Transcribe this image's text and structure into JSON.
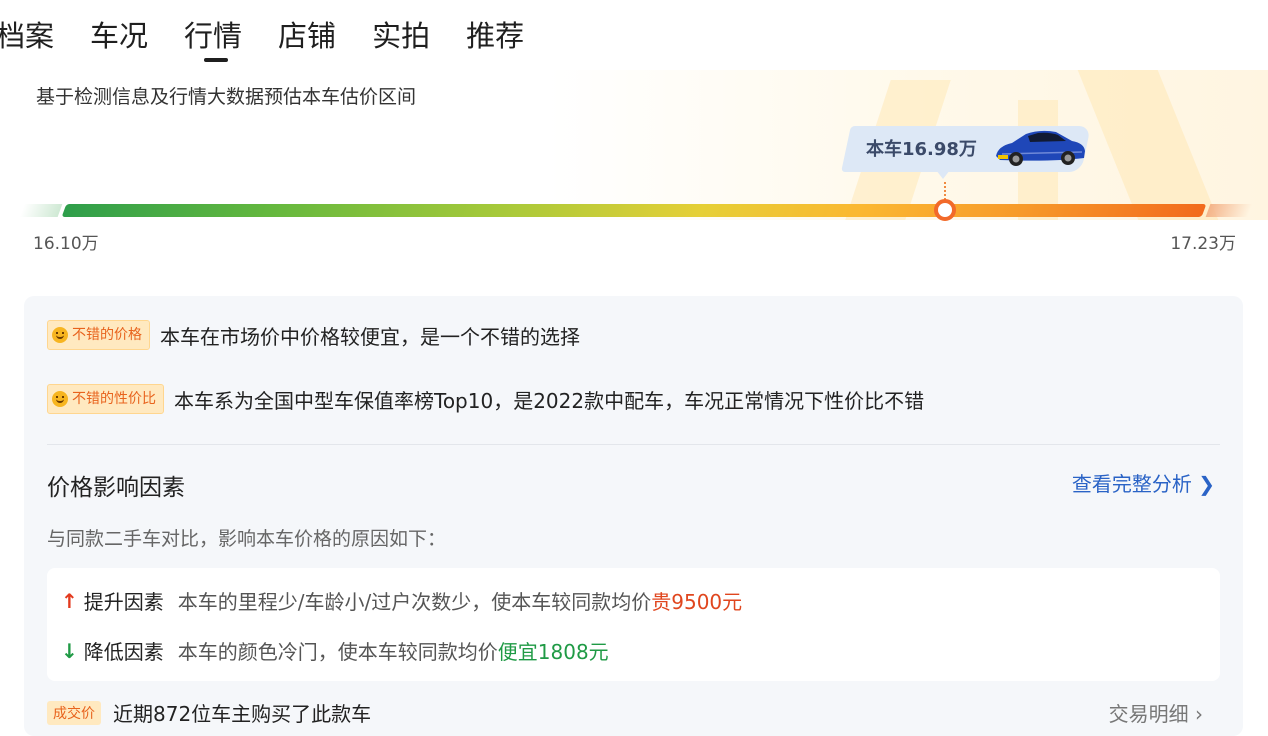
{
  "tabs": [
    "档案",
    "车况",
    "行情",
    "店铺",
    "实拍",
    "推荐"
  ],
  "active_tab": "行情",
  "price": {
    "description": "基于检测信息及行情大数据预估本车估价区间",
    "bubble_label": "本车16.98万",
    "min_label": "16.10万",
    "max_label": "17.23万",
    "current_fraction": 0.78
  },
  "tags": [
    {
      "tag": "不错的价格",
      "text": "本车在市场价中价格较便宜，是一个不错的选择"
    },
    {
      "tag": "不错的性价比",
      "text": "本车系为全国中型车保值率榜Top10，是2022款中配车，车况正常情况下性价比不错"
    }
  ],
  "factors": {
    "title": "价格影响因素",
    "link": "查看完整分析",
    "subtitle": "与同款二手车对比，影响本车价格的原因如下：",
    "up": {
      "arrow": "↑",
      "label": "提升因素",
      "desc": "本车的里程少/车龄小/过户次数少，使本车较同款均价",
      "highlight": "贵9500元"
    },
    "down": {
      "arrow": "↓",
      "label": "降低因素",
      "desc": "本车的颜色冷门，使本车较同款均价",
      "highlight": "便宜1808元"
    }
  },
  "bottom": {
    "tag": "成交价",
    "text": "近期872位车主购买了此款车",
    "link": "交易明细 ›"
  },
  "colors": {
    "accent_blue": "#2a63c6",
    "up_red": "#e0461e",
    "down_green": "#1f9a45",
    "tag_orange": "#e8631d"
  }
}
